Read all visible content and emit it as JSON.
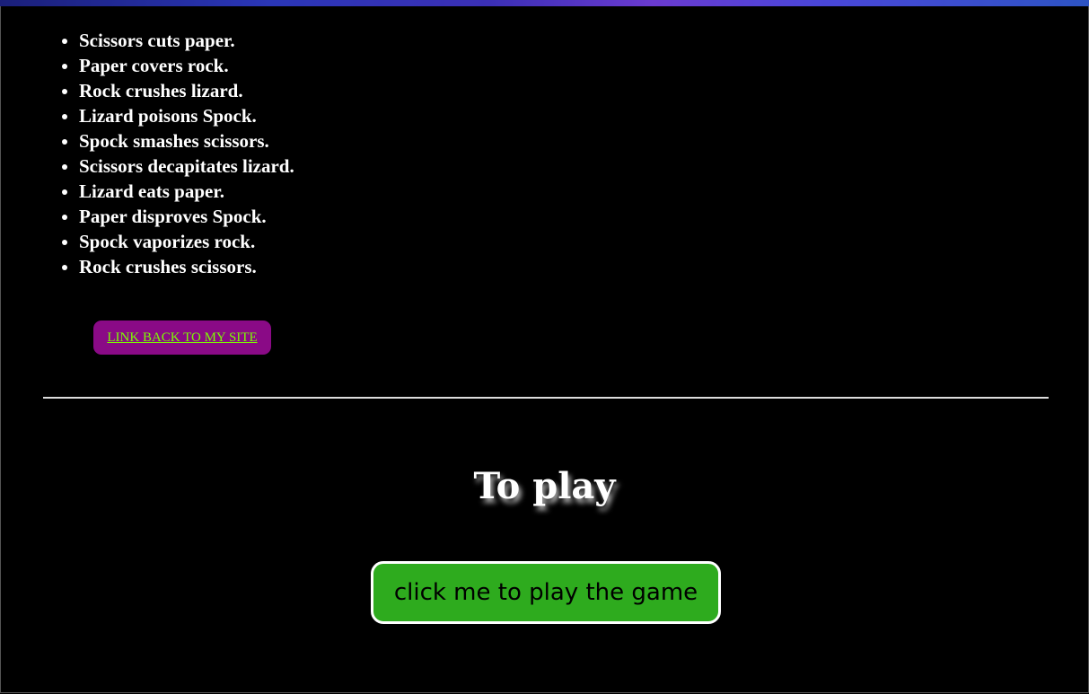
{
  "rules": {
    "items": [
      "Scissors cuts paper.",
      "Paper covers rock.",
      "Rock crushes lizard.",
      "Lizard poisons Spock.",
      "Spock smashes scissors.",
      "Scissors decapitates lizard.",
      "Lizard eats paper.",
      "Paper disproves Spock.",
      "Spock vaporizes rock.",
      "Rock crushes scissors."
    ]
  },
  "link_back": {
    "label": "LINK BACK TO MY SITE"
  },
  "play_section": {
    "heading": "To play",
    "button_label": "click me to play the game"
  },
  "colors": {
    "background": "#000000",
    "link_button_bg": "#8a0a86",
    "link_text": "#7CFC00",
    "play_button_bg": "#2eab1e",
    "text": "#ffffff"
  }
}
